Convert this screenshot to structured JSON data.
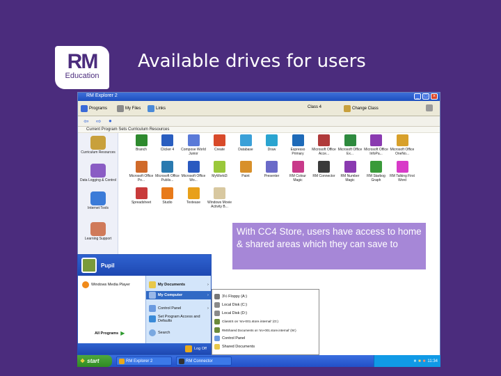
{
  "slide": {
    "title": "Available drives for users"
  },
  "logo": {
    "line1": "RM",
    "line2": "Education"
  },
  "window": {
    "title": "RM Explorer 2"
  },
  "toolbar": {
    "programs": "Programs",
    "my_files": "My Files",
    "links": "Links",
    "class": "Class 4",
    "change_class": "Change Class"
  },
  "address": {
    "path": "Current Program Sets Curriculum Resources"
  },
  "left_pane": [
    {
      "label": "Curriculum Resources",
      "color": "#c8a03c"
    },
    {
      "label": "Data Logging & Control",
      "color": "#8a5cc4"
    },
    {
      "label": "Internet Tools",
      "color": "#3b7bd8"
    },
    {
      "label": "Learning Support",
      "color": "#d07a5a"
    }
  ],
  "programs": [
    {
      "label": "Branch",
      "color": "#2e8a2e"
    },
    {
      "label": "Clicker 4",
      "color": "#2a5ec0"
    },
    {
      "label": "Compose World Junior",
      "color": "#5a7ad8"
    },
    {
      "label": "Create",
      "color": "#d84a2a"
    },
    {
      "label": "Database",
      "color": "#3aa0d8"
    },
    {
      "label": "Draw",
      "color": "#2aa4d0"
    },
    {
      "label": "Espresso Primary",
      "color": "#1e6ab8"
    },
    {
      "label": "Microsoft Office Acce...",
      "color": "#b03a3a"
    },
    {
      "label": "Microsoft Office Ex...",
      "color": "#2e8a3e"
    },
    {
      "label": "Microsoft Office InfoPa...",
      "color": "#8a3ab0"
    },
    {
      "label": "Microsoft Office OneNo...",
      "color": "#d8a02a"
    },
    {
      "label": "Microsoft Office Po...",
      "color": "#d06a2a"
    },
    {
      "label": "Microsoft Office Publis...",
      "color": "#2a7ab0"
    },
    {
      "label": "Microsoft Office Wo...",
      "color": "#2a5ac0"
    },
    {
      "label": "MyWorld3",
      "color": "#9ac83a"
    },
    {
      "label": "Paint",
      "color": "#d8902a"
    },
    {
      "label": "Presenter",
      "color": "#6a6ac8"
    },
    {
      "label": "RM Colour Magic",
      "color": "#c83a8a"
    },
    {
      "label": "RM Connector",
      "color": "#3a3a3a"
    },
    {
      "label": "RM Number Magic",
      "color": "#8a3ab0"
    },
    {
      "label": "RM Starbog Graph",
      "color": "#3a9a3a"
    },
    {
      "label": "RM Talking First Word",
      "color": "#d83ac8"
    },
    {
      "label": "Spreadsheet",
      "color": "#c83a3a"
    },
    {
      "label": "Studio",
      "color": "#e87a1a"
    },
    {
      "label": "Textease",
      "color": "#e8a01a"
    },
    {
      "label": "Windows Movie Activity B...",
      "color": "#d8c8a0"
    }
  ],
  "callout": {
    "text": "With CC4 Store, users have access to home & shared areas which they can save to"
  },
  "start_menu": {
    "user": "Pupil",
    "pinned": "Windows Media Player",
    "all_programs": "All Programs",
    "right": [
      "My Documents",
      "My Computer",
      "Control Panel",
      "Set Program Access and Defaults",
      "Search"
    ],
    "log_off": "Log Off"
  },
  "submenu": {
    "items": [
      "3½ Floppy (A:)",
      "Local Disk (C:)",
      "Local Disk (D:)",
      "ClassIS on 'srv-001.store.internal' (O:)",
      "RMShared Documents on 'srv-001.store.internal' (W:)",
      "Control Panel",
      "Shared Documents"
    ]
  },
  "taskbar": {
    "start": "start",
    "task1": "RM Explorer 2",
    "task2": "RM Connector",
    "time": "11:34"
  }
}
